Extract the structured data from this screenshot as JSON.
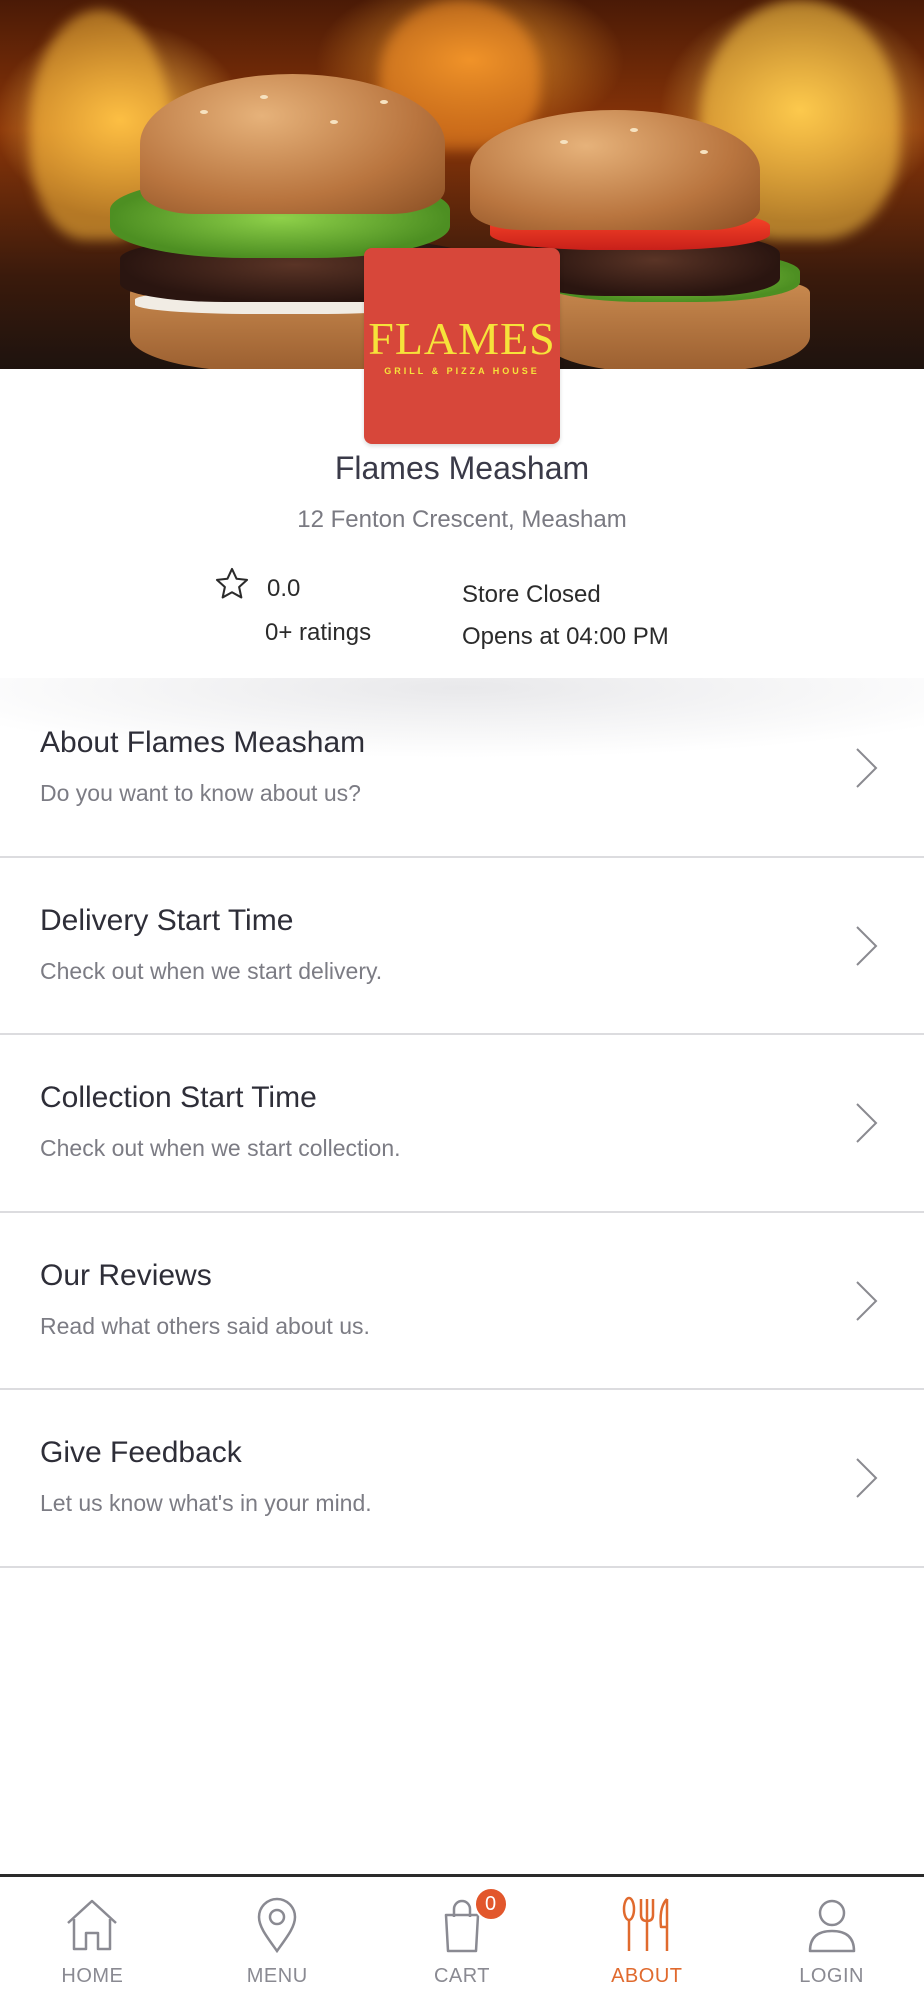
{
  "hero": {
    "logo_text": "FLAMES",
    "logo_subtitle": "GRILL & PIZZA HOUSE"
  },
  "store": {
    "name": "Flames Measham",
    "address": "12 Fenton Crescent, Measham",
    "rating_value": "0.0",
    "rating_count": "0+ ratings",
    "status": "Store Closed",
    "opens_at": "Opens at 04:00 PM"
  },
  "menu_items": [
    {
      "title": "About Flames Measham",
      "subtitle": "Do you want to know about us?"
    },
    {
      "title": "Delivery Start Time",
      "subtitle": "Check out when we start delivery."
    },
    {
      "title": "Collection Start Time",
      "subtitle": "Check out when we start collection."
    },
    {
      "title": "Our Reviews",
      "subtitle": "Read what others said about us."
    },
    {
      "title": "Give Feedback",
      "subtitle": "Let us know what's in your mind."
    }
  ],
  "nav": {
    "items": [
      {
        "label": "HOME",
        "icon": "home-icon"
      },
      {
        "label": "MENU",
        "icon": "location-pin-icon"
      },
      {
        "label": "CART",
        "icon": "shopping-bag-icon"
      },
      {
        "label": "ABOUT",
        "icon": "cutlery-icon"
      },
      {
        "label": "LOGIN",
        "icon": "user-icon"
      }
    ],
    "active": "ABOUT",
    "cart_count": "0"
  },
  "colors": {
    "accent": "#e06a2e",
    "logo_bg": "#d7473a",
    "logo_text": "#f6e33a",
    "badge": "#e2572c"
  }
}
